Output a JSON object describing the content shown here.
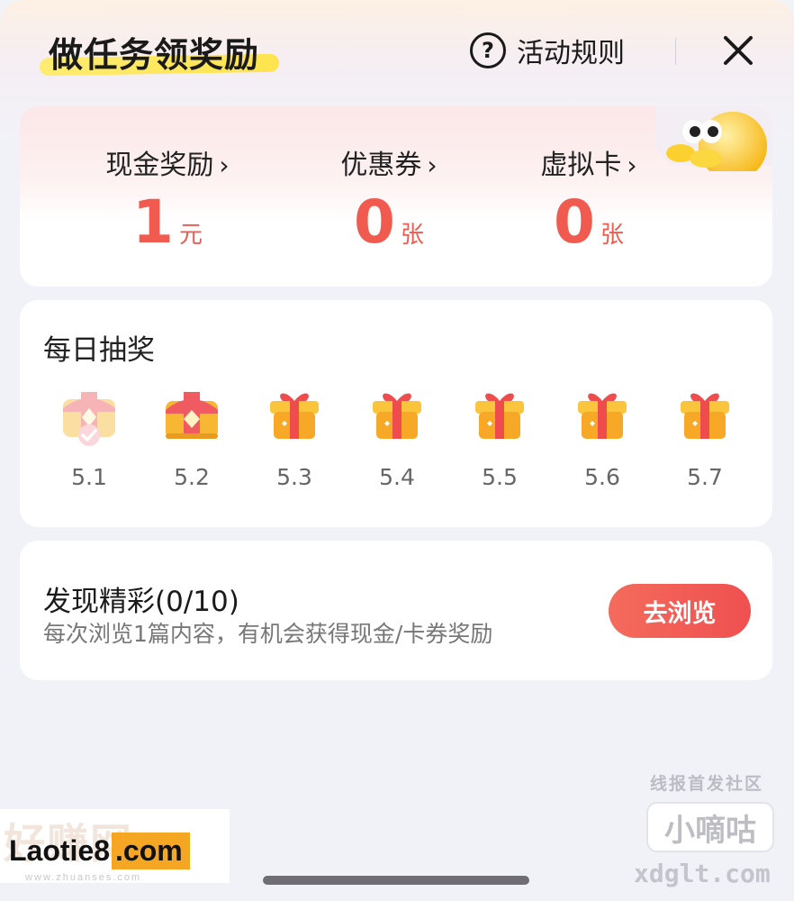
{
  "header": {
    "title": "做任务领奖励",
    "rules_label": "活动规则",
    "rules_icon": "question-circle-icon",
    "close_icon": "close-icon"
  },
  "rewards": [
    {
      "label": "现金奖励",
      "chevron": "›",
      "value": "1",
      "unit": "元"
    },
    {
      "label": "优惠券",
      "chevron": "›",
      "value": "0",
      "unit": "张"
    },
    {
      "label": "虚拟卡",
      "chevron": "›",
      "value": "0",
      "unit": "张"
    }
  ],
  "daily_lottery": {
    "title": "每日抽奖",
    "days": [
      {
        "label": "5.1",
        "icon": "treasure-chest-claimed-icon",
        "claimed": true
      },
      {
        "label": "5.2",
        "icon": "treasure-chest-icon",
        "claimed": false
      },
      {
        "label": "5.3",
        "icon": "gift-box-icon",
        "claimed": false
      },
      {
        "label": "5.4",
        "icon": "gift-box-icon",
        "claimed": false
      },
      {
        "label": "5.5",
        "icon": "gift-box-icon",
        "claimed": false
      },
      {
        "label": "5.6",
        "icon": "gift-box-icon",
        "claimed": false
      },
      {
        "label": "5.7",
        "icon": "gift-box-icon",
        "claimed": false
      }
    ]
  },
  "discover": {
    "title": "发现精彩(0/10)",
    "subtitle": "每次浏览1篇内容，有机会获得现金/卡券奖励",
    "button_label": "去浏览"
  },
  "watermarks": {
    "right_top": "线报首发社区",
    "right_box": "小嘀咕",
    "right_bottom": "xdglt.com",
    "left_ghost": "好赚网",
    "left_main": "Laotie8",
    "left_com": ".com",
    "left_sub": "www.zhuanses.com"
  },
  "colors": {
    "accent_red": "#f05a4f",
    "title_highlight": "#ffe23c",
    "gift_orange": "#f7b733",
    "background": "#f1f2f8"
  }
}
